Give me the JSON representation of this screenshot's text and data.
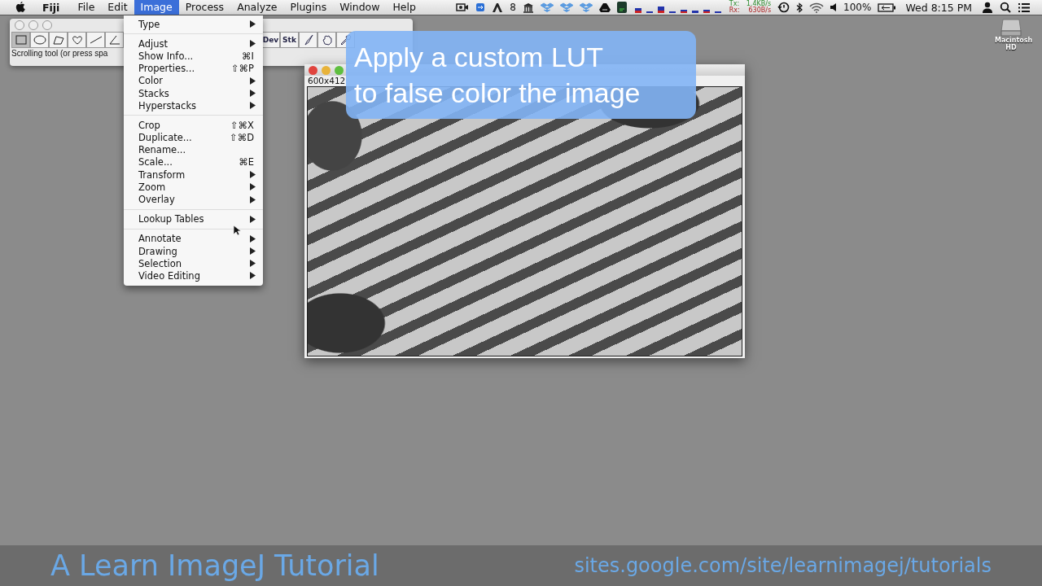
{
  "menubar": {
    "app": "Fiji",
    "items": [
      {
        "label": "File",
        "selected": false
      },
      {
        "label": "Edit",
        "selected": false
      },
      {
        "label": "Image",
        "selected": true
      },
      {
        "label": "Process",
        "selected": false
      },
      {
        "label": "Analyze",
        "selected": false
      },
      {
        "label": "Plugins",
        "selected": false
      },
      {
        "label": "Window",
        "selected": false
      },
      {
        "label": "Help",
        "selected": false
      }
    ],
    "status": {
      "adobe_count": "8",
      "tx_label": "Tx:",
      "rx_label": "Rx:",
      "tx_rate": "1.4KB/s",
      "rx_rate": "630B/s",
      "battery": "100%",
      "clock": "Wed 8:15 PM"
    }
  },
  "image_menu": {
    "groups": [
      [
        {
          "label": "Type",
          "submenu": true
        }
      ],
      [
        {
          "label": "Adjust",
          "submenu": true
        },
        {
          "label": "Show Info...",
          "shortcut": "⌘I",
          "submenu": false
        },
        {
          "label": "Properties...",
          "shortcut": "⇧⌘P",
          "submenu": false
        },
        {
          "label": "Color",
          "submenu": true
        },
        {
          "label": "Stacks",
          "submenu": true
        },
        {
          "label": "Hyperstacks",
          "submenu": true
        }
      ],
      [
        {
          "label": "Crop",
          "shortcut": "⇧⌘X",
          "submenu": false
        },
        {
          "label": "Duplicate...",
          "shortcut": "⇧⌘D",
          "submenu": false
        },
        {
          "label": "Rename...",
          "submenu": false
        },
        {
          "label": "Scale...",
          "shortcut": "⌘E",
          "submenu": false
        },
        {
          "label": "Transform",
          "submenu": true
        },
        {
          "label": "Zoom",
          "submenu": true
        },
        {
          "label": "Overlay",
          "submenu": true
        }
      ],
      [
        {
          "label": "Lookup Tables",
          "submenu": true
        }
      ],
      [
        {
          "label": "Annotate",
          "submenu": true
        },
        {
          "label": "Drawing",
          "submenu": true
        },
        {
          "label": "Selection",
          "submenu": true
        },
        {
          "label": "Video Editing",
          "submenu": true
        }
      ]
    ]
  },
  "toolbar": {
    "right_tools": [
      "Dev",
      "Stk"
    ],
    "status": "Scrolling tool (or press spa"
  },
  "image_window": {
    "info": "600x412"
  },
  "caption": [
    "Apply a custom LUT",
    "to false color the image"
  ],
  "desktop_icon": {
    "label": "Macintosh HD"
  },
  "footer": {
    "title": "A Learn ImageJ Tutorial",
    "url": "sites.google.com/site/learnimagej/tutorials"
  }
}
